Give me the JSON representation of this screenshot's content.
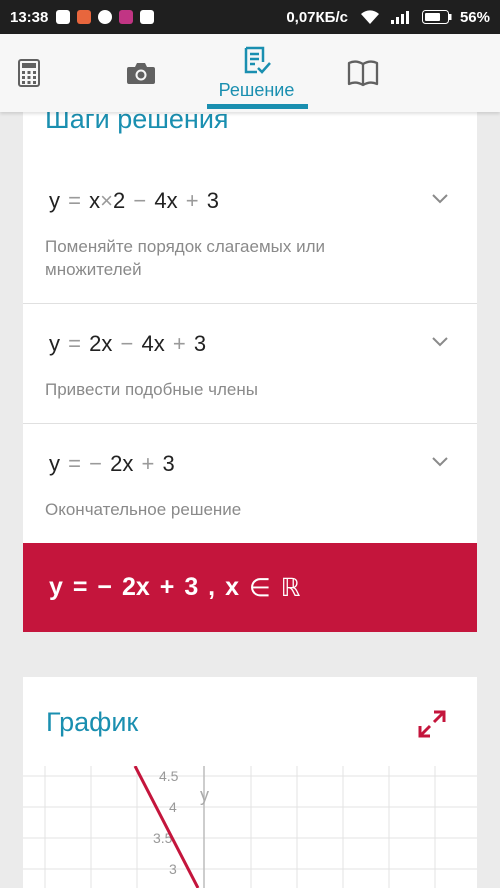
{
  "status_bar": {
    "time": "13:38",
    "speed": "0,07КБ/с",
    "battery": "56%"
  },
  "tabs": {
    "calculator_icon": "calculator-icon",
    "camera_icon": "camera-icon",
    "solution_icon": "document-check-icon",
    "solution_label": "Решение",
    "book_icon": "book-icon"
  },
  "steps": {
    "title": "Шаги решения",
    "items": [
      {
        "equation": [
          "y",
          "=",
          "x",
          "×",
          "2",
          "−",
          "4x",
          "+",
          "3"
        ],
        "description": "Поменяйте порядок слагаемых или множителей"
      },
      {
        "equation": [
          "y",
          "=",
          "2x",
          "−",
          "4x",
          "+",
          "3"
        ],
        "description": "Привести подобные члены"
      },
      {
        "equation": [
          "y",
          "=",
          "−",
          "2x",
          "+",
          "3"
        ],
        "description": "Окончательное решение"
      }
    ],
    "final": [
      "y",
      "=",
      "−",
      "2x",
      "+",
      "3",
      ",",
      "x",
      "∈",
      "ℝ"
    ]
  },
  "graph": {
    "title": "График",
    "y_axis_label": "y",
    "tick_labels": [
      "4.5",
      "4",
      "3.5",
      "3"
    ],
    "line_equation": "y = -2x + 3",
    "colors": {
      "line": "#c4153c",
      "grid": "#e3e3e3"
    }
  },
  "colors": {
    "accent": "#1a8fb0",
    "final_background": "#c4153c",
    "status_bar": "#1f1f1f"
  }
}
